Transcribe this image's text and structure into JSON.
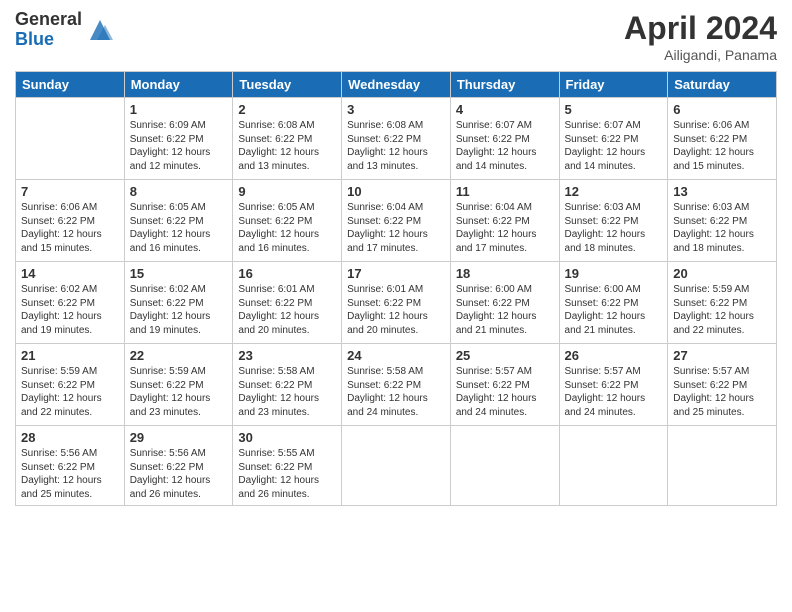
{
  "header": {
    "logo_general": "General",
    "logo_blue": "Blue",
    "month_title": "April 2024",
    "location": "Ailigandi, Panama"
  },
  "days_of_week": [
    "Sunday",
    "Monday",
    "Tuesday",
    "Wednesday",
    "Thursday",
    "Friday",
    "Saturday"
  ],
  "weeks": [
    [
      {
        "day": "",
        "sunrise": "",
        "sunset": "",
        "daylight": ""
      },
      {
        "day": "1",
        "sunrise": "Sunrise: 6:09 AM",
        "sunset": "Sunset: 6:22 PM",
        "daylight": "Daylight: 12 hours and 12 minutes."
      },
      {
        "day": "2",
        "sunrise": "Sunrise: 6:08 AM",
        "sunset": "Sunset: 6:22 PM",
        "daylight": "Daylight: 12 hours and 13 minutes."
      },
      {
        "day": "3",
        "sunrise": "Sunrise: 6:08 AM",
        "sunset": "Sunset: 6:22 PM",
        "daylight": "Daylight: 12 hours and 13 minutes."
      },
      {
        "day": "4",
        "sunrise": "Sunrise: 6:07 AM",
        "sunset": "Sunset: 6:22 PM",
        "daylight": "Daylight: 12 hours and 14 minutes."
      },
      {
        "day": "5",
        "sunrise": "Sunrise: 6:07 AM",
        "sunset": "Sunset: 6:22 PM",
        "daylight": "Daylight: 12 hours and 14 minutes."
      },
      {
        "day": "6",
        "sunrise": "Sunrise: 6:06 AM",
        "sunset": "Sunset: 6:22 PM",
        "daylight": "Daylight: 12 hours and 15 minutes."
      }
    ],
    [
      {
        "day": "7",
        "sunrise": "Sunrise: 6:06 AM",
        "sunset": "Sunset: 6:22 PM",
        "daylight": "Daylight: 12 hours and 15 minutes."
      },
      {
        "day": "8",
        "sunrise": "Sunrise: 6:05 AM",
        "sunset": "Sunset: 6:22 PM",
        "daylight": "Daylight: 12 hours and 16 minutes."
      },
      {
        "day": "9",
        "sunrise": "Sunrise: 6:05 AM",
        "sunset": "Sunset: 6:22 PM",
        "daylight": "Daylight: 12 hours and 16 minutes."
      },
      {
        "day": "10",
        "sunrise": "Sunrise: 6:04 AM",
        "sunset": "Sunset: 6:22 PM",
        "daylight": "Daylight: 12 hours and 17 minutes."
      },
      {
        "day": "11",
        "sunrise": "Sunrise: 6:04 AM",
        "sunset": "Sunset: 6:22 PM",
        "daylight": "Daylight: 12 hours and 17 minutes."
      },
      {
        "day": "12",
        "sunrise": "Sunrise: 6:03 AM",
        "sunset": "Sunset: 6:22 PM",
        "daylight": "Daylight: 12 hours and 18 minutes."
      },
      {
        "day": "13",
        "sunrise": "Sunrise: 6:03 AM",
        "sunset": "Sunset: 6:22 PM",
        "daylight": "Daylight: 12 hours and 18 minutes."
      }
    ],
    [
      {
        "day": "14",
        "sunrise": "Sunrise: 6:02 AM",
        "sunset": "Sunset: 6:22 PM",
        "daylight": "Daylight: 12 hours and 19 minutes."
      },
      {
        "day": "15",
        "sunrise": "Sunrise: 6:02 AM",
        "sunset": "Sunset: 6:22 PM",
        "daylight": "Daylight: 12 hours and 19 minutes."
      },
      {
        "day": "16",
        "sunrise": "Sunrise: 6:01 AM",
        "sunset": "Sunset: 6:22 PM",
        "daylight": "Daylight: 12 hours and 20 minutes."
      },
      {
        "day": "17",
        "sunrise": "Sunrise: 6:01 AM",
        "sunset": "Sunset: 6:22 PM",
        "daylight": "Daylight: 12 hours and 20 minutes."
      },
      {
        "day": "18",
        "sunrise": "Sunrise: 6:00 AM",
        "sunset": "Sunset: 6:22 PM",
        "daylight": "Daylight: 12 hours and 21 minutes."
      },
      {
        "day": "19",
        "sunrise": "Sunrise: 6:00 AM",
        "sunset": "Sunset: 6:22 PM",
        "daylight": "Daylight: 12 hours and 21 minutes."
      },
      {
        "day": "20",
        "sunrise": "Sunrise: 5:59 AM",
        "sunset": "Sunset: 6:22 PM",
        "daylight": "Daylight: 12 hours and 22 minutes."
      }
    ],
    [
      {
        "day": "21",
        "sunrise": "Sunrise: 5:59 AM",
        "sunset": "Sunset: 6:22 PM",
        "daylight": "Daylight: 12 hours and 22 minutes."
      },
      {
        "day": "22",
        "sunrise": "Sunrise: 5:59 AM",
        "sunset": "Sunset: 6:22 PM",
        "daylight": "Daylight: 12 hours and 23 minutes."
      },
      {
        "day": "23",
        "sunrise": "Sunrise: 5:58 AM",
        "sunset": "Sunset: 6:22 PM",
        "daylight": "Daylight: 12 hours and 23 minutes."
      },
      {
        "day": "24",
        "sunrise": "Sunrise: 5:58 AM",
        "sunset": "Sunset: 6:22 PM",
        "daylight": "Daylight: 12 hours and 24 minutes."
      },
      {
        "day": "25",
        "sunrise": "Sunrise: 5:57 AM",
        "sunset": "Sunset: 6:22 PM",
        "daylight": "Daylight: 12 hours and 24 minutes."
      },
      {
        "day": "26",
        "sunrise": "Sunrise: 5:57 AM",
        "sunset": "Sunset: 6:22 PM",
        "daylight": "Daylight: 12 hours and 24 minutes."
      },
      {
        "day": "27",
        "sunrise": "Sunrise: 5:57 AM",
        "sunset": "Sunset: 6:22 PM",
        "daylight": "Daylight: 12 hours and 25 minutes."
      }
    ],
    [
      {
        "day": "28",
        "sunrise": "Sunrise: 5:56 AM",
        "sunset": "Sunset: 6:22 PM",
        "daylight": "Daylight: 12 hours and 25 minutes."
      },
      {
        "day": "29",
        "sunrise": "Sunrise: 5:56 AM",
        "sunset": "Sunset: 6:22 PM",
        "daylight": "Daylight: 12 hours and 26 minutes."
      },
      {
        "day": "30",
        "sunrise": "Sunrise: 5:55 AM",
        "sunset": "Sunset: 6:22 PM",
        "daylight": "Daylight: 12 hours and 26 minutes."
      },
      {
        "day": "",
        "sunrise": "",
        "sunset": "",
        "daylight": ""
      },
      {
        "day": "",
        "sunrise": "",
        "sunset": "",
        "daylight": ""
      },
      {
        "day": "",
        "sunrise": "",
        "sunset": "",
        "daylight": ""
      },
      {
        "day": "",
        "sunrise": "",
        "sunset": "",
        "daylight": ""
      }
    ]
  ]
}
